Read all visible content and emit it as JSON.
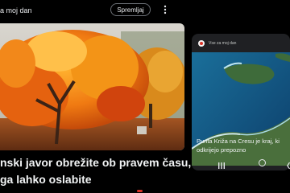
{
  "header": {
    "title": "a moj dan",
    "follow_label": "Spremljaj",
    "more_icon": "more-vert-icon"
  },
  "main_article": {
    "headline_line1": "nski javor obrežite ob pravem času,",
    "headline_line2": "ga lahko oslabite",
    "image": "orange-maple-tree-photo"
  },
  "side_article": {
    "source": "Vse za moj dan",
    "headline_line1": "Punta Križa na Cresu je kraj, ki",
    "headline_line2": "odkrijejo prepozno",
    "image": "coastline-aerial-photo"
  },
  "navbar": {
    "recents_icon": "recents-icon",
    "home_icon": "home-icon",
    "back_icon": "back-icon"
  },
  "colors": {
    "background": "#000000",
    "card": "#1f2023",
    "text": "#e8eaed",
    "accent_red": "#d93025"
  }
}
